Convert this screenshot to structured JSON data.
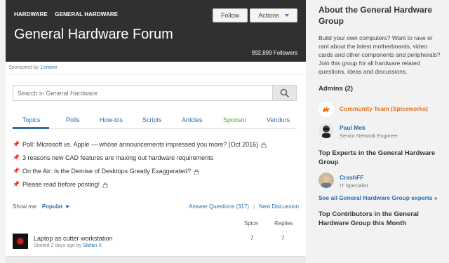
{
  "header": {
    "breadcrumbs": [
      "HARDWARE",
      "GENERAL HARDWARE"
    ],
    "title": "General Hardware Forum",
    "follow_label": "Follow",
    "actions_label": "Actions",
    "followers": "992,899 Followers"
  },
  "sponsor": {
    "prefix": "Sponsored by",
    "name": "Lenovo"
  },
  "search": {
    "placeholder": "Search in General Hardware"
  },
  "tabs": [
    {
      "label": "Topics",
      "active": true
    },
    {
      "label": "Polls"
    },
    {
      "label": "How-tos"
    },
    {
      "label": "Scripts"
    },
    {
      "label": "Articles"
    },
    {
      "label": "Sponsor"
    },
    {
      "label": "Vendors"
    }
  ],
  "pinned": [
    "Poll: Microsoft vs. Apple — whose announcements impressed you more? (Oct 2016)",
    "3 reasons new CAD features are maxing out hardware requirements",
    "On the Air: Is the Demise of Desktops Greatly Exaggerated?",
    "Please read before posting!"
  ],
  "list_controls": {
    "show_me": "Show me:",
    "filter": "Popular",
    "answer_questions": "Answer Questions",
    "answer_count": "(317)",
    "separator": "|",
    "new_discussion": "New Discussion"
  },
  "columns": {
    "spice": "Spice",
    "replies": "Replies"
  },
  "topics": [
    {
      "title": "Laptop as cutter workstation",
      "started": "Started 2 days ago by",
      "author": "Stefan X",
      "spice": "7",
      "replies": "7"
    }
  ],
  "sidebar": {
    "about_title": "About the General Hardware Group",
    "about_text": "Build your own computers? Want to rave or rant about the latest motherboards, video cards and other components and peripherals? Join this group for all hardware related questions, ideas and discussions.",
    "admins_title": "Admins (2)",
    "admins": [
      {
        "name": "Community Team (Spiceworks)",
        "role": ""
      },
      {
        "name": "Paul Mek",
        "role": "Senior Network Engineer"
      }
    ],
    "experts_title": "Top Experts in the General Hardware Group",
    "experts": [
      {
        "name": "CrashFF",
        "role": "IT Specialist"
      }
    ],
    "experts_link": "See all General Hardware Group experts »",
    "contributors_title": "Top Contributors in the General Hardware Group this Month"
  },
  "colors": {
    "accent": "#2a6fb0",
    "header_bg": "#303030",
    "sponsor_green": "#5aa52f",
    "orange": "#e8701a"
  }
}
